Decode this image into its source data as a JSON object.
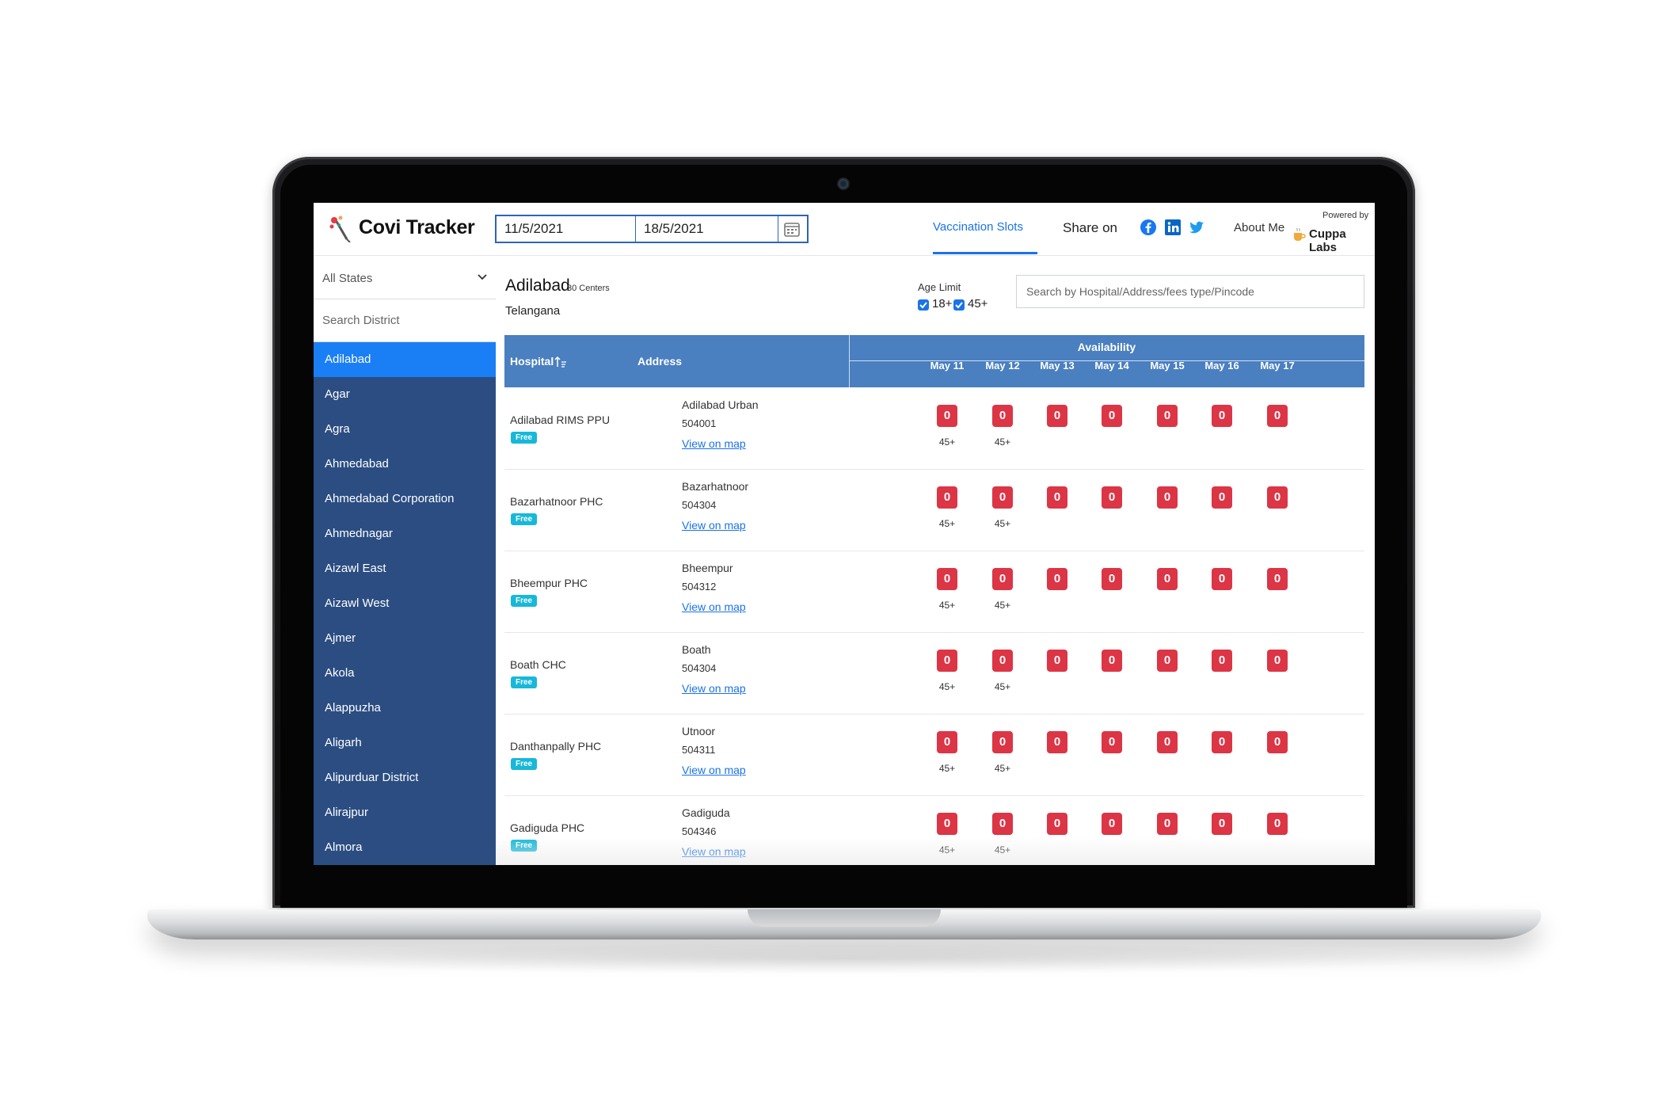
{
  "app": {
    "brand": "Covi Tracker",
    "date_from": "11/5/2021",
    "date_to": "18/5/2021",
    "nav_slots": "Vaccination Slots",
    "share_label": "Share on",
    "about": "About Me",
    "powered_by": "Powered by",
    "company": "Cuppa Labs"
  },
  "sidebar": {
    "state_select": "All States",
    "district_search_placeholder": "Search District",
    "districts": [
      "Adilabad",
      "Agar",
      "Agra",
      "Ahmedabad",
      "Ahmedabad Corporation",
      "Ahmednagar",
      "Aizawl East",
      "Aizawl West",
      "Ajmer",
      "Akola",
      "Alappuzha",
      "Aligarh",
      "Alipurduar District",
      "Alirajpur",
      "Almora"
    ],
    "active_index": 0
  },
  "main": {
    "city": "Adilabad",
    "centers": "30 Centers",
    "state": "Telangana",
    "age_limit_label": "Age Limit",
    "age_options": [
      "18+",
      "45+"
    ],
    "search_placeholder": "Search by Hospital/Address/fees type/Pincode"
  },
  "table": {
    "headers": {
      "hospital": "Hospital",
      "address": "Address",
      "availability": "Availability"
    },
    "dates": [
      "May 11",
      "May 12",
      "May 13",
      "May 14",
      "May 15",
      "May 16",
      "May 17"
    ],
    "rows": [
      {
        "hospital": "Adilabad RIMS PPU",
        "fee": "Free",
        "address": "Adilabad Urban",
        "pincode": "504001",
        "map": "View on map",
        "slots": [
          "0",
          "0",
          "0",
          "0",
          "0",
          "0",
          "0"
        ],
        "ages": [
          "45+",
          "45+",
          "",
          "",
          "",
          "",
          ""
        ]
      },
      {
        "hospital": "Bazarhatnoor PHC",
        "fee": "Free",
        "address": "Bazarhatnoor",
        "pincode": "504304",
        "map": "View on map",
        "slots": [
          "0",
          "0",
          "0",
          "0",
          "0",
          "0",
          "0"
        ],
        "ages": [
          "45+",
          "45+",
          "",
          "",
          "",
          "",
          ""
        ]
      },
      {
        "hospital": "Bheempur PHC",
        "fee": "Free",
        "address": "Bheempur",
        "pincode": "504312",
        "map": "View on map",
        "slots": [
          "0",
          "0",
          "0",
          "0",
          "0",
          "0",
          "0"
        ],
        "ages": [
          "45+",
          "45+",
          "",
          "",
          "",
          "",
          ""
        ]
      },
      {
        "hospital": "Boath CHC",
        "fee": "Free",
        "address": "Boath",
        "pincode": "504304",
        "map": "View on map",
        "slots": [
          "0",
          "0",
          "0",
          "0",
          "0",
          "0",
          "0"
        ],
        "ages": [
          "45+",
          "45+",
          "",
          "",
          "",
          "",
          ""
        ]
      },
      {
        "hospital": "Danthanpally PHC",
        "fee": "Free",
        "address": "Utnoor",
        "pincode": "504311",
        "map": "View on map",
        "slots": [
          "0",
          "0",
          "0",
          "0",
          "0",
          "0",
          "0"
        ],
        "ages": [
          "45+",
          "45+",
          "",
          "",
          "",
          "",
          ""
        ]
      },
      {
        "hospital": "Gadiguda PHC",
        "fee": "Free",
        "address": "Gadiguda",
        "pincode": "504346",
        "map": "View on map",
        "slots": [
          "0",
          "0",
          "0",
          "0",
          "0",
          "0",
          "0"
        ],
        "ages": [
          "45+",
          "45+",
          "",
          "",
          "",
          "",
          ""
        ]
      }
    ]
  },
  "colors": {
    "sidebar_bg": "#2b4d82",
    "active_item": "#1a7ff5",
    "table_header": "#4a7fc0",
    "slot_badge": "#dc3545",
    "free_badge": "#17b8d9",
    "link": "#1a73e8"
  },
  "icons": [
    "logo-icon",
    "calendar-icon",
    "chevron-down-icon",
    "sort-icon",
    "facebook-icon",
    "linkedin-icon",
    "twitter-icon",
    "cup-icon",
    "checkbox-icon"
  ]
}
